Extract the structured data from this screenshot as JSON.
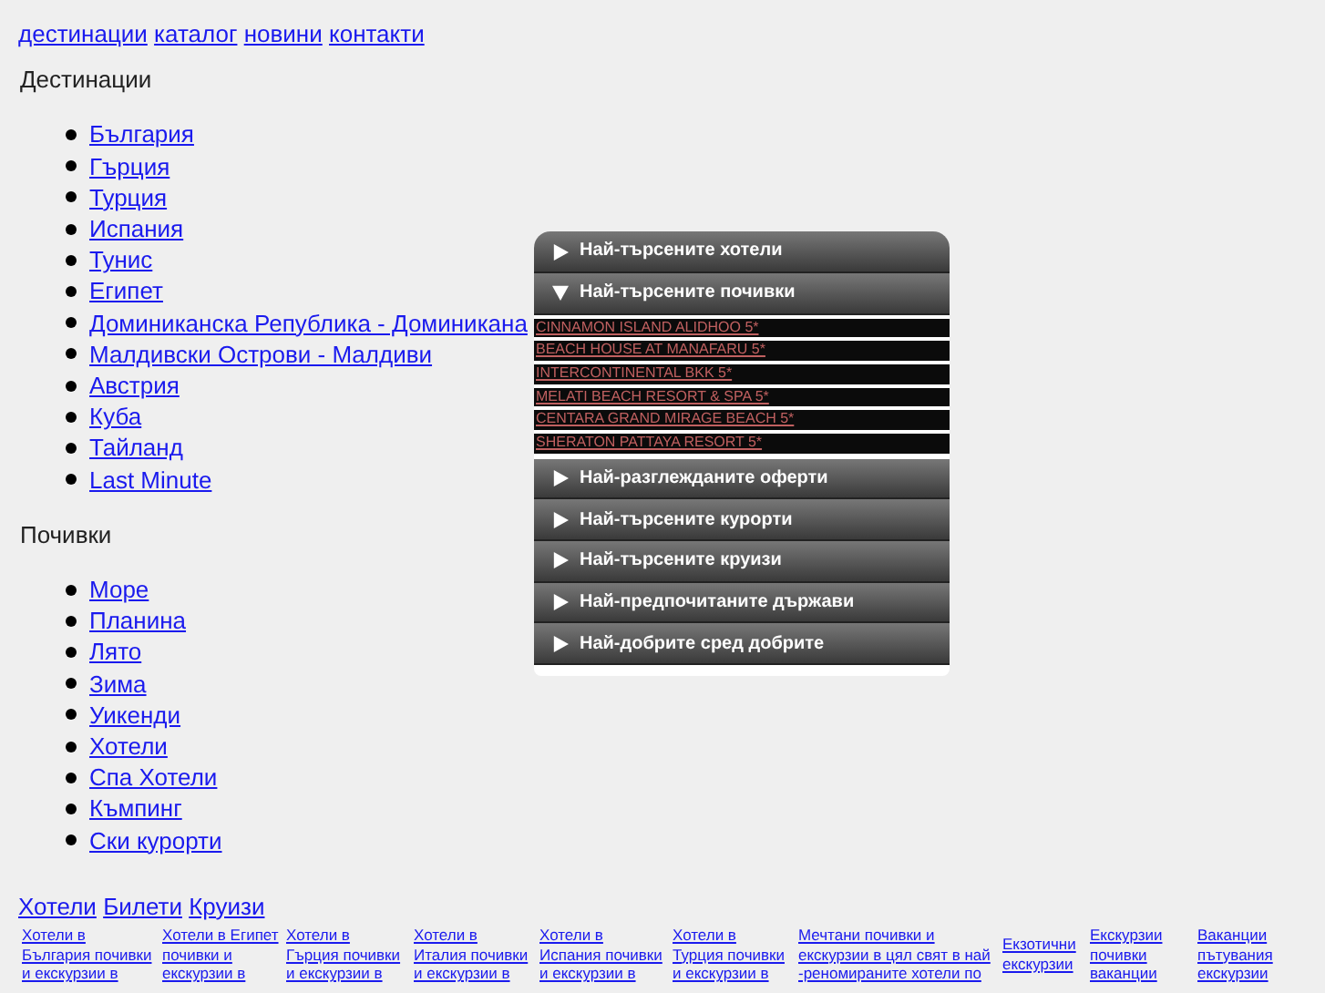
{
  "top_nav": [
    "дестинации",
    "каталог",
    "новини",
    "контакти"
  ],
  "sections": [
    {
      "heading": "Дестинации",
      "items": [
        "България",
        "Гърция",
        "Турция",
        "Испания",
        "Тунис",
        "Египет",
        "Доминиканска Република - Доминикана",
        "Малдивски Острови - Малдиви",
        "Австрия",
        "Куба",
        "Тайланд",
        "Last Minute"
      ]
    },
    {
      "heading": "Почивки",
      "items": [
        "Море",
        "Планина",
        "Лято",
        "Зима",
        "Уикенди",
        "Хотели",
        "Спа Хотели",
        "Къмпинг",
        "Ски курорти"
      ]
    }
  ],
  "accordion": [
    {
      "title": "Най-търсените хотели",
      "expanded": false
    },
    {
      "title": "Най-търсените почивки",
      "expanded": true,
      "links": [
        "CINNAMON ISLAND ALIDHOO 5*",
        "BEACH HOUSE AT MANAFARU 5*",
        "INTERCONTINENTAL BKK 5*",
        "MELATI BEACH RESORT & SPA 5*",
        "CENTARA GRAND MIRAGE BEACH 5*",
        "SHERATON PATTAYA RESORT 5*"
      ]
    },
    {
      "title": "Най-разглежданите оферти",
      "expanded": false
    },
    {
      "title": "Най-търсените курорти",
      "expanded": false
    },
    {
      "title": "Най-търсените круизи",
      "expanded": false
    },
    {
      "title": "Най-предпочитаните държави",
      "expanded": false
    },
    {
      "title": "Най-добрите сред добрите",
      "expanded": false
    }
  ],
  "bottom_nav": [
    "Хотели",
    "Билети",
    "Круизи"
  ],
  "hotel_links": [
    "Хотели в България почивки и екскурзии в",
    "Хотели в Египет почивки и екскурзии в",
    "Хотели в Гърция почивки и екскурзии в",
    "Хотели в Италия почивки и екскурзии в",
    "Хотели в Испания почивки и екскурзии в",
    "Хотели в Турция почивки и екскурзии в",
    "Мечтани почивки и екскурзии в цял свят в най -реномираните хотели по",
    "Екзотични екскурзии",
    "Екскурзии почивки ваканции",
    "Ваканции пътувания екскурзии"
  ]
}
